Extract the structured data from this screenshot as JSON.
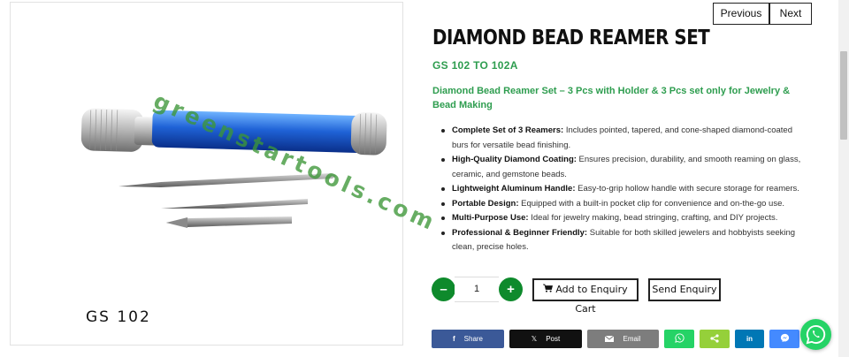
{
  "gallery": {
    "thumb_code": "GS 102",
    "watermark": "greenstartools.com",
    "image_code": "GS 102"
  },
  "nav": {
    "previous_label": "Previous",
    "next_label": "Next"
  },
  "product": {
    "title": "DIAMOND BEAD REAMER SET",
    "code": "GS 102 TO 102A",
    "subtitle": "Diamond Bead Reamer Set – 3 Pcs with Holder & 3 Pcs set only for Jewelry & Bead Making",
    "features": [
      {
        "bold": "Complete Set of 3 Reamers:",
        "text": " Includes pointed, tapered, and cone-shaped diamond-coated burs for versatile bead finishing."
      },
      {
        "bold": "High-Quality Diamond Coating:",
        "text": " Ensures precision, durability, and smooth reaming on glass, ceramic, and gemstone beads."
      },
      {
        "bold": "Lightweight Aluminum Handle:",
        "text": " Easy-to-grip hollow handle with secure storage for reamers."
      },
      {
        "bold": "Portable Design:",
        "text": " Equipped with a built-in pocket clip for convenience and on-the-go use."
      },
      {
        "bold": "Multi-Purpose Use:",
        "text": " Ideal for jewelry making, bead stringing, crafting, and DIY projects."
      },
      {
        "bold": "Professional & Beginner Friendly:",
        "text": " Suitable for both skilled jewelers and hobbyists seeking clean, precise holes."
      }
    ]
  },
  "quantity": {
    "minus": "–",
    "value": "1",
    "plus": "+"
  },
  "actions": {
    "add_to_cart": "Add to Enquiry Cart",
    "send_enquiry": "Send Enquiry"
  },
  "share": {
    "facebook": "Share",
    "x": "Post",
    "email": "Email",
    "icons": [
      "facebook-icon",
      "x-icon",
      "email-icon",
      "whatsapp-icon",
      "share-icon",
      "linkedin-icon",
      "messenger-icon"
    ]
  },
  "colors": {
    "accent_green": "#2e9d4f",
    "button_green": "#0e8a2c",
    "facebook": "#3b5998",
    "x": "#111111",
    "email": "#7d7d7d",
    "whatsapp": "#25d366",
    "share": "#95d03a",
    "linkedin": "#0077b5",
    "messenger": "#448aff"
  }
}
